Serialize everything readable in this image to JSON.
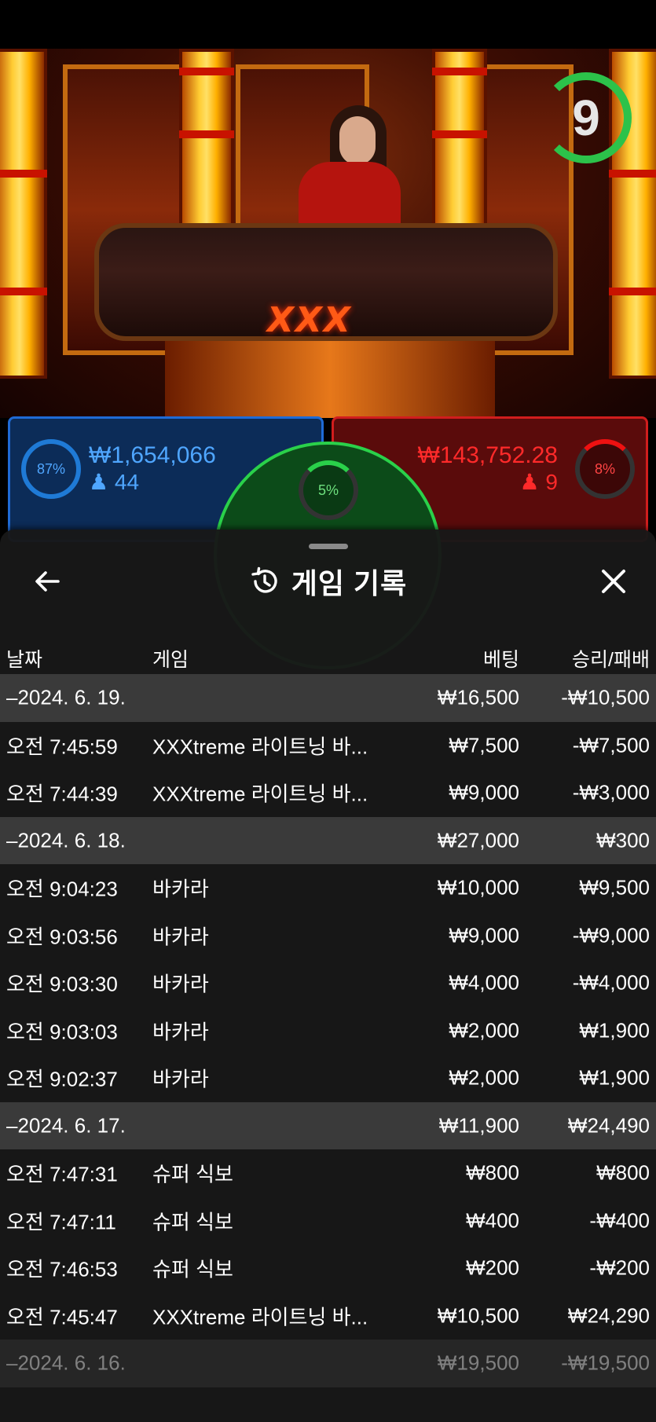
{
  "video": {
    "logo": "XXX",
    "countdown": "9"
  },
  "bets": {
    "player": {
      "percent": "87%",
      "amount": "₩1,654,066",
      "count": "44"
    },
    "banker": {
      "percent": "8%",
      "amount": "₩143,752.28",
      "count": "9"
    },
    "tie": {
      "percent": "5%"
    }
  },
  "sheet": {
    "title": "게임 기록",
    "columns": [
      "날짜",
      "게임",
      "베팅",
      "승리/패배"
    ],
    "rows": [
      {
        "type": "group",
        "date": "–2024. 6. 19.",
        "game": "",
        "bet": "₩16,500",
        "result": "-₩10,500"
      },
      {
        "type": "item",
        "date": "오전 7:45:59",
        "game": "XXXtreme 라이트닝 바...",
        "bet": "₩7,500",
        "result": "-₩7,500"
      },
      {
        "type": "item",
        "date": "오전 7:44:39",
        "game": "XXXtreme 라이트닝 바...",
        "bet": "₩9,000",
        "result": "-₩3,000"
      },
      {
        "type": "group",
        "date": "–2024. 6. 18.",
        "game": "",
        "bet": "₩27,000",
        "result": "₩300"
      },
      {
        "type": "item",
        "date": "오전 9:04:23",
        "game": "바카라",
        "bet": "₩10,000",
        "result": "₩9,500"
      },
      {
        "type": "item",
        "date": "오전 9:03:56",
        "game": "바카라",
        "bet": "₩9,000",
        "result": "-₩9,000"
      },
      {
        "type": "item",
        "date": "오전 9:03:30",
        "game": "바카라",
        "bet": "₩4,000",
        "result": "-₩4,000"
      },
      {
        "type": "item",
        "date": "오전 9:03:03",
        "game": "바카라",
        "bet": "₩2,000",
        "result": "₩1,900"
      },
      {
        "type": "item",
        "date": "오전 9:02:37",
        "game": "바카라",
        "bet": "₩2,000",
        "result": "₩1,900"
      },
      {
        "type": "group",
        "date": "–2024. 6. 17.",
        "game": "",
        "bet": "₩11,900",
        "result": "₩24,490"
      },
      {
        "type": "item",
        "date": "오전 7:47:31",
        "game": "슈퍼 식보",
        "bet": "₩800",
        "result": "₩800"
      },
      {
        "type": "item",
        "date": "오전 7:47:11",
        "game": "슈퍼 식보",
        "bet": "₩400",
        "result": "-₩400"
      },
      {
        "type": "item",
        "date": "오전 7:46:53",
        "game": "슈퍼 식보",
        "bet": "₩200",
        "result": "-₩200"
      },
      {
        "type": "item",
        "date": "오전 7:45:47",
        "game": "XXXtreme 라이트닝 바...",
        "bet": "₩10,500",
        "result": "₩24,290"
      },
      {
        "type": "group",
        "date": "–2024. 6. 16.",
        "game": "",
        "bet": "₩19,500",
        "result": "-₩19,500",
        "faded": true
      }
    ]
  }
}
